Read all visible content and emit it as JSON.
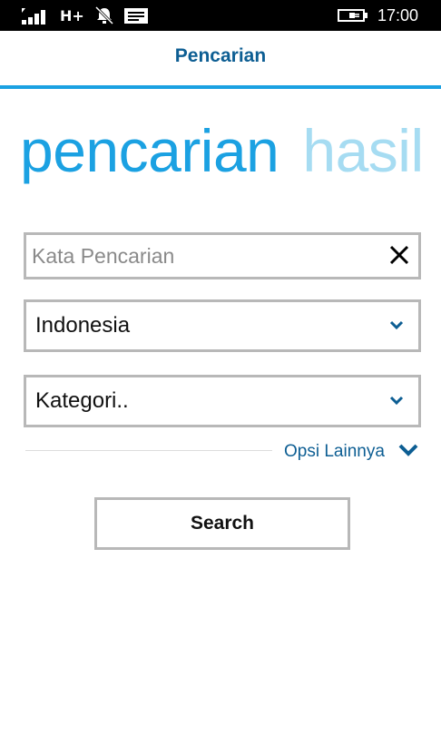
{
  "status_bar": {
    "network": "H+",
    "time": "17:00",
    "icons": [
      "signal-icon",
      "bell-muted-icon",
      "message-icon",
      "battery-charging-icon"
    ]
  },
  "header": {
    "title": "Pencarian"
  },
  "pivot": {
    "items": [
      "pencarian",
      "hasil"
    ],
    "active": "pencarian"
  },
  "search": {
    "placeholder": "Kata Pencarian",
    "value": ""
  },
  "country_select": {
    "value": "Indonesia"
  },
  "category_select": {
    "value": "Kategori.."
  },
  "more_options": {
    "label": "Opsi Lainnya"
  },
  "actions": {
    "search_label": "Search"
  },
  "colors": {
    "accent": "#1ba1e2",
    "accent_light": "#a6dcf2",
    "title": "#0d5e93",
    "border": "#b8b8b8"
  }
}
